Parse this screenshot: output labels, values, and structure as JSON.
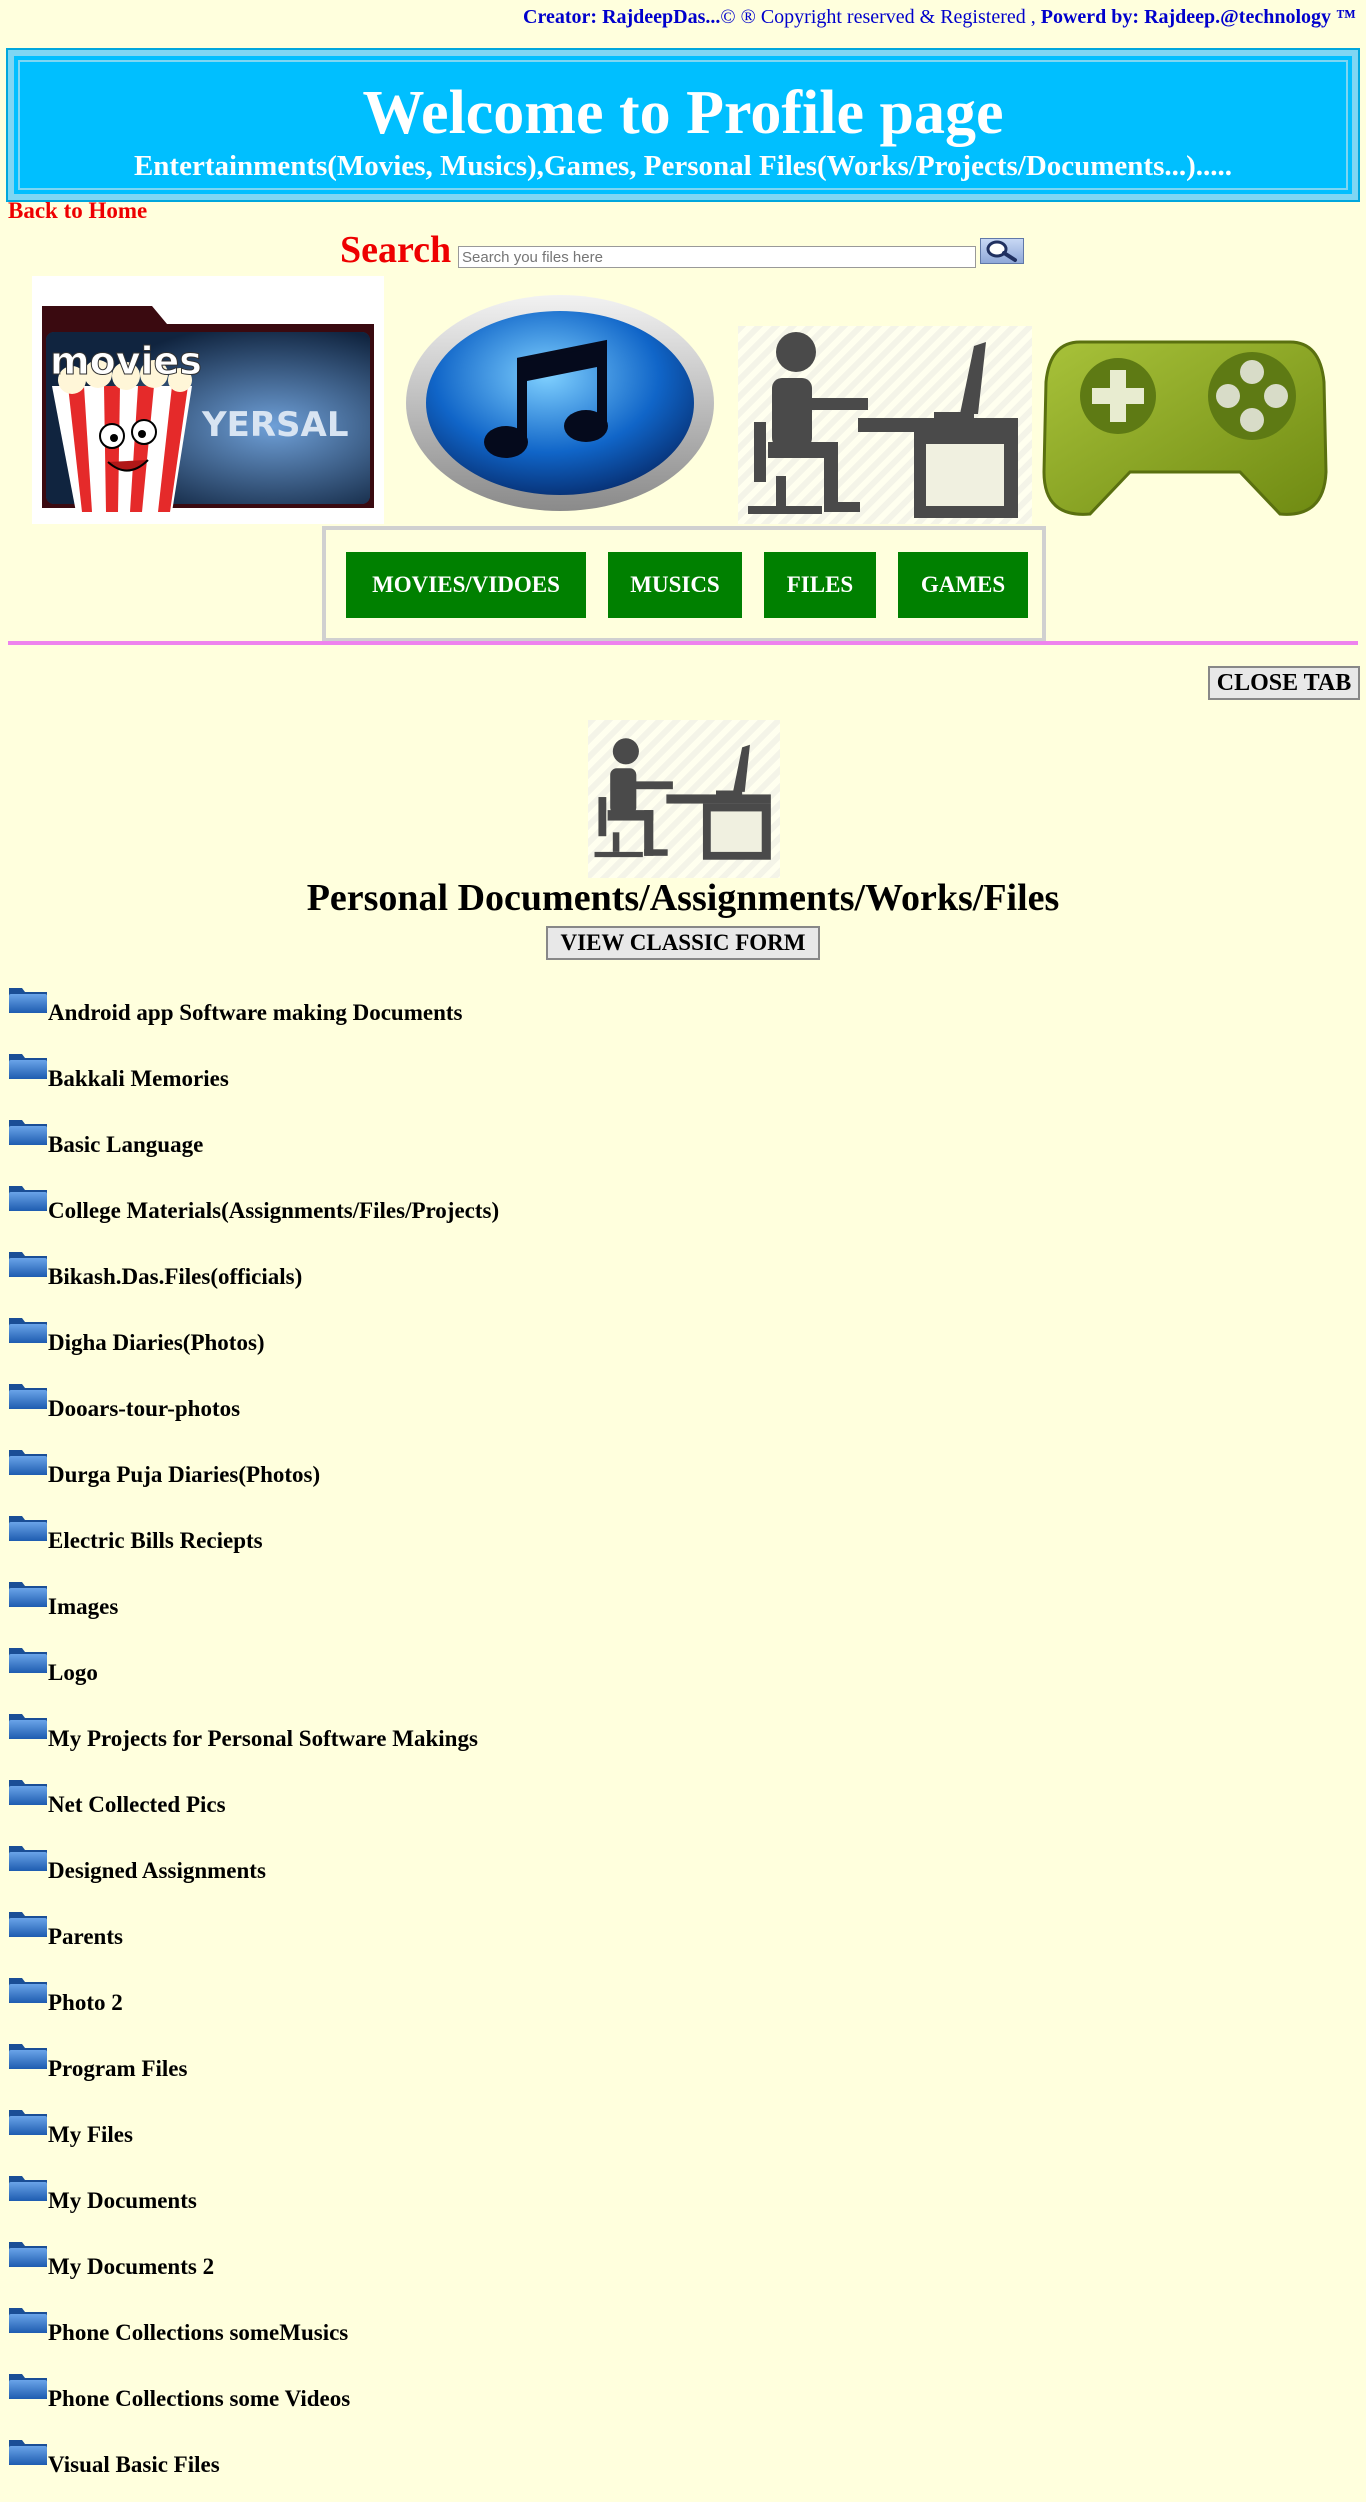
{
  "credits": {
    "creator": "Creator: RajdeepDas...",
    "copyright": "© ® Copyright reserved & Registered ,",
    "powered": "Powerd by: Rajdeep.@technology ™"
  },
  "banner": {
    "title": "Welcome to Profile page",
    "subtitle": "Entertainments(Movies, Musics),Games, Personal Files(Works/Projects/Documents...)....."
  },
  "back_home": "Back to Home",
  "search": {
    "label": "Search",
    "placeholder": "Search you files here"
  },
  "tiles": {
    "movies_text": "movies",
    "movies_sub": "YERSAL"
  },
  "nav": [
    "MOVIES/VIDOES",
    "MUSICS",
    "FILES",
    "GAMES"
  ],
  "close_tab": "CLOSE TAB",
  "section": {
    "title": "Personal Documents/Assignments/Works/Files",
    "classic_button": "VIEW CLASSIC FORM"
  },
  "folders": [
    "Android app Software making Documents",
    "Bakkali Memories",
    "Basic Language",
    "College Materials(Assignments/Files/Projects)",
    "Bikash.Das.Files(officials)",
    "Digha Diaries(Photos)",
    "Dooars-tour-photos",
    "Durga Puja Diaries(Photos)",
    "Electric Bills Reciepts",
    "Images",
    "Logo",
    "My Projects for Personal Software Makings",
    "Net Collected Pics",
    "Designed Assignments",
    "Parents",
    "Photo 2",
    "Program Files",
    "My Files",
    "My Documents",
    "My Documents 2",
    "Phone Collections someMusics",
    "Phone Collections some Videos",
    "Visual Basic Files"
  ],
  "colors": {
    "background": "#ffffdd",
    "banner": "#00bfff",
    "accent_red": "#ee0000",
    "nav_green": "#008000",
    "divider": "#ee82ee",
    "credits_blue": "#0000cc"
  },
  "icons": {
    "movies_tile": "movies-folder-popcorn-icon",
    "music_tile": "music-note-icon",
    "files_tile": "person-at-desk-icon",
    "games_tile": "gamepad-icon",
    "folder": "folder-icon",
    "search_button": "magnifier-icon"
  }
}
